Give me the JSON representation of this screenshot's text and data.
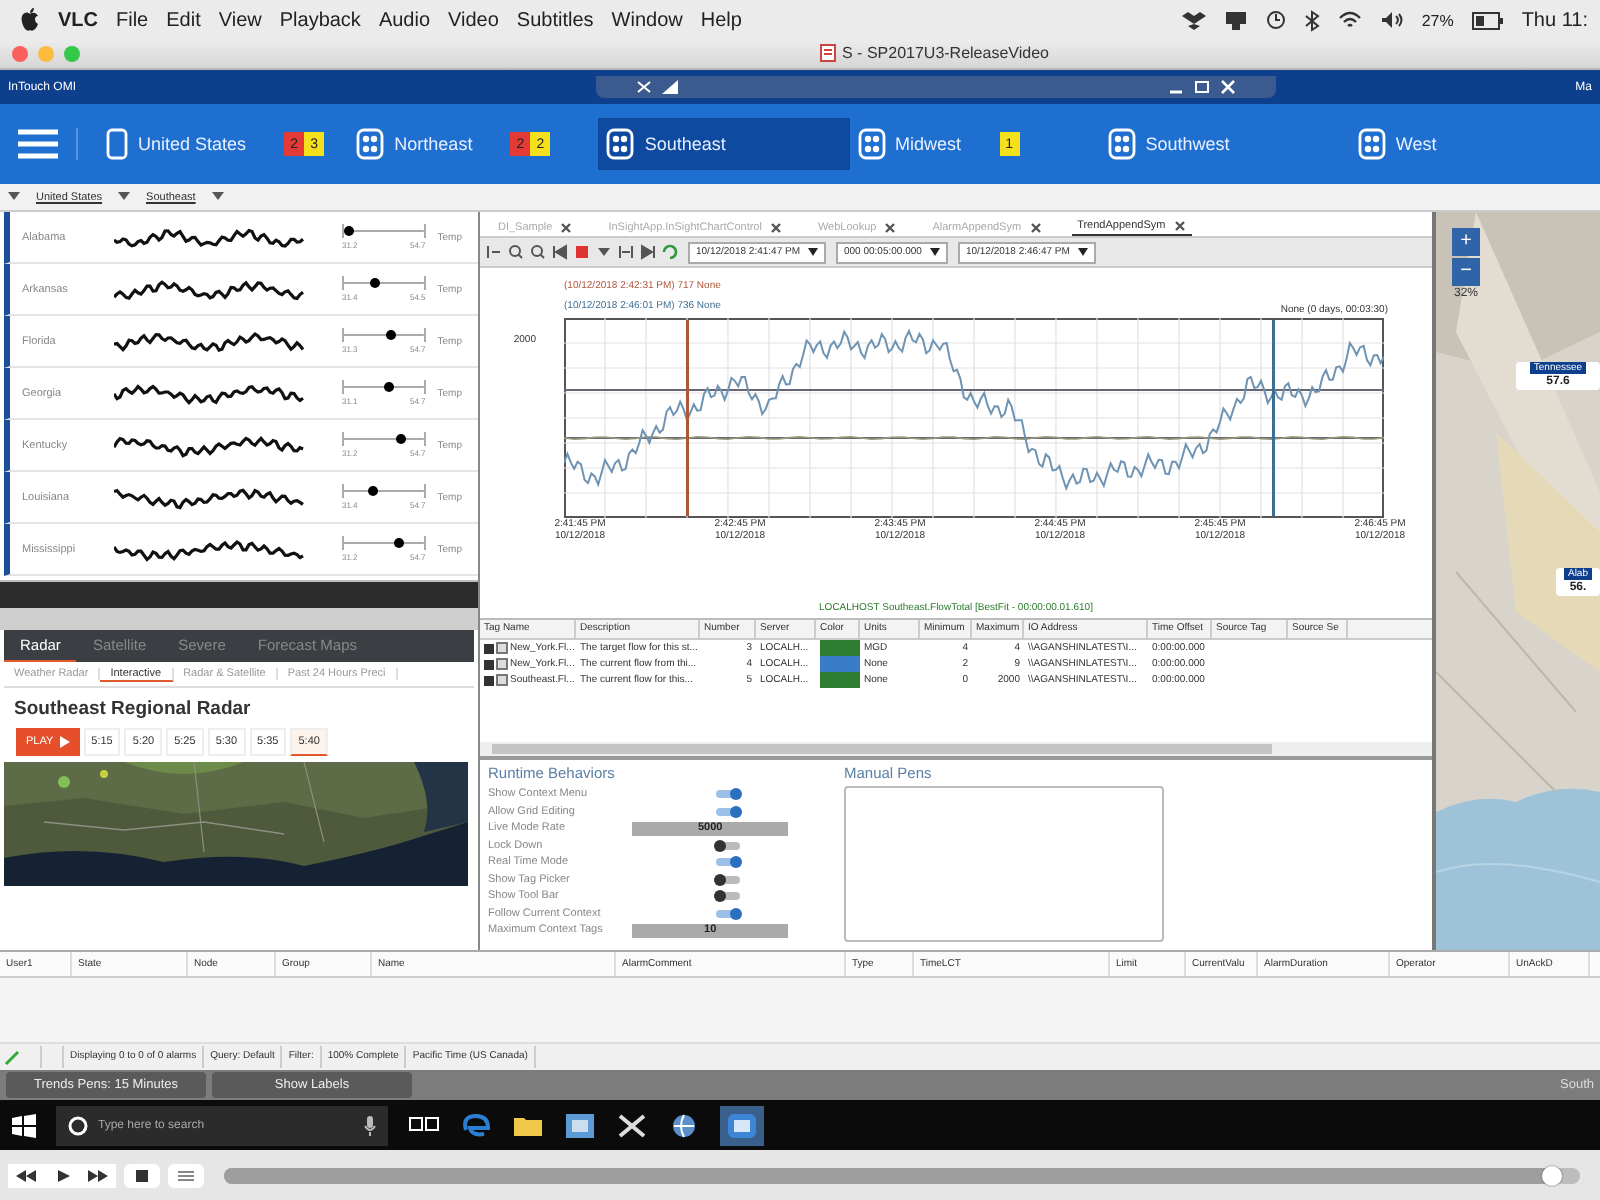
{
  "menubar": {
    "app": "VLC",
    "items": [
      "File",
      "Edit",
      "View",
      "Playback",
      "Audio",
      "Video",
      "Subtitles",
      "Window",
      "Help"
    ],
    "battery": "27%",
    "clock": "Thu 11:"
  },
  "window": {
    "title": "S - SP2017U3-ReleaseVideo"
  },
  "app_header": {
    "title": "InTouch OMI",
    "right": "Ma"
  },
  "nav": [
    {
      "label": "United States",
      "selected": false,
      "badges": [
        {
          "text": "2",
          "color": "#e53935"
        },
        {
          "text": "3",
          "color": "#f5e11b"
        }
      ]
    },
    {
      "label": "Northeast",
      "selected": false,
      "badges": [
        {
          "text": "2",
          "color": "#e53935"
        },
        {
          "text": "2",
          "color": "#f5e11b"
        }
      ]
    },
    {
      "label": "Southeast",
      "selected": true
    },
    {
      "label": "Midwest",
      "selected": false,
      "badges": [
        {
          "text": "1",
          "color": "#f5e11b"
        }
      ]
    },
    {
      "label": "Southwest",
      "selected": false
    },
    {
      "label": "West",
      "selected": false
    }
  ],
  "breadcrumb": [
    "United States",
    "Southeast"
  ],
  "states": [
    {
      "name": "Alabama",
      "level": 0.05,
      "min": "31.2",
      "max": "54.7",
      "unit": "Temp"
    },
    {
      "name": "Arkansas",
      "level": 0.38,
      "min": "31.4",
      "max": "54.5",
      "unit": "Temp"
    },
    {
      "name": "Florida",
      "level": 0.57,
      "min": "31.3",
      "max": "54.7",
      "unit": "Temp"
    },
    {
      "name": "Georgia",
      "level": 0.55,
      "min": "31.1",
      "max": "54.7",
      "unit": "Temp"
    },
    {
      "name": "Kentucky",
      "level": 0.7,
      "min": "31.2",
      "max": "54.7",
      "unit": "Temp"
    },
    {
      "name": "Louisiana",
      "level": 0.35,
      "min": "31.4",
      "max": "54.7",
      "unit": "Temp"
    },
    {
      "name": "Mississippi",
      "level": 0.68,
      "min": "31.2",
      "max": "54.7",
      "unit": "Temp"
    }
  ],
  "radar": {
    "tabs": [
      {
        "label": "Radar",
        "selected": true
      },
      {
        "label": "Satellite",
        "selected": false
      },
      {
        "label": "Severe",
        "selected": false
      },
      {
        "label": "Forecast Maps",
        "selected": false
      }
    ],
    "subtabs": [
      {
        "label": "Weather Radar",
        "selected": false
      },
      {
        "label": "Interactive",
        "selected": true
      },
      {
        "label": "Radar & Satellite",
        "selected": false
      },
      {
        "label": "Past 24 Hours Preci",
        "selected": false
      }
    ],
    "heading": "Southeast Regional Radar",
    "play": "PLAY",
    "times": [
      {
        "label": "5:15",
        "selected": false
      },
      {
        "label": "5:20",
        "selected": false
      },
      {
        "label": "5:25",
        "selected": false
      },
      {
        "label": "5:30",
        "selected": false
      },
      {
        "label": "5:35",
        "selected": false
      },
      {
        "label": "5:40",
        "selected": true
      }
    ]
  },
  "trend": {
    "tabs": [
      {
        "label": "DI_Sample",
        "selected": false
      },
      {
        "label": "InSightApp.InSightChartControl",
        "selected": false
      },
      {
        "label": "WebLookup",
        "selected": false
      },
      {
        "label": "AlarmAppendSym",
        "selected": false
      },
      {
        "label": "TrendAppendSym",
        "selected": true
      }
    ],
    "toolbar": {
      "start": "10/12/2018  2:41:47 PM",
      "duration": "000 00:05:00.000",
      "end": "10/12/2018  2:46:47 PM"
    },
    "legend": [
      {
        "text": "(10/12/2018 2:42:31 PM) 717 None",
        "color": "#b0553a"
      },
      {
        "text": "(10/12/2018 2:46:01 PM) 736 None",
        "color": "#3d6f94"
      }
    ],
    "cursor_info": "None (0 days, 00:03:30)",
    "y_label": "2000",
    "x_labels": [
      {
        "time": "2:41:45 PM",
        "date": "10/12/2018"
      },
      {
        "time": "2:42:45 PM",
        "date": "10/12/2018"
      },
      {
        "time": "2:43:45 PM",
        "date": "10/12/2018"
      },
      {
        "time": "2:44:45 PM",
        "date": "10/12/2018"
      },
      {
        "time": "2:45:45 PM",
        "date": "10/12/2018"
      },
      {
        "time": "2:46:45 PM",
        "date": "10/12/2018"
      }
    ],
    "caption": "LOCALHOST Southeast.FlowTotal [BestFit - 00:00:00.01.610]"
  },
  "tag_table": {
    "columns": [
      "Tag Name",
      "Description",
      "Number",
      "Server",
      "Color",
      "Units",
      "Minimum",
      "Maximum",
      "IO Address",
      "Time Offset",
      "Source Tag",
      "Source Se"
    ],
    "rows": [
      {
        "checked": true,
        "color": "#2e7d32",
        "cells": [
          "New_York.Fl...",
          "The target flow for this st...",
          "3",
          "LOCALH...",
          "",
          "MGD",
          "4",
          "4",
          "\\\\AGANSHINLATEST\\I...",
          "0:00:00.000"
        ]
      },
      {
        "checked": true,
        "color": "#3a7cc8",
        "cells": [
          "New_York.Fl...",
          "The current flow from thi...",
          "4",
          "LOCALH...",
          "",
          "None",
          "2",
          "9",
          "\\\\AGANSHINLATEST\\I...",
          "0:00:00.000"
        ]
      },
      {
        "checked": true,
        "color": "#2e7d32",
        "cells": [
          "Southeast.Fl...",
          "The current flow for this...",
          "5",
          "LOCALH...",
          "",
          "None",
          "0",
          "2000",
          "\\\\AGANSHINLATEST\\I...",
          "0:00:00.000"
        ]
      }
    ]
  },
  "runtime": {
    "title": "Runtime Behaviors",
    "items": [
      {
        "kind": "toggle",
        "label": "Show Context Menu",
        "on": true
      },
      {
        "kind": "toggle",
        "label": "Allow Grid Editing",
        "on": true
      },
      {
        "kind": "number",
        "label": "Live Mode Rate",
        "value": "5000"
      },
      {
        "kind": "toggle",
        "label": "Lock Down",
        "on": false
      },
      {
        "kind": "toggle",
        "label": "Real Time Mode",
        "on": true
      },
      {
        "kind": "toggle",
        "label": "Show Tag Picker",
        "on": false
      },
      {
        "kind": "toggle",
        "label": "Show Tool Bar",
        "on": false
      },
      {
        "kind": "toggle",
        "label": "Follow Current Context",
        "on": true
      },
      {
        "kind": "number",
        "label": "Maximum Context Tags",
        "value": "10"
      }
    ]
  },
  "manual_pens": {
    "title": "Manual Pens"
  },
  "map": {
    "zoom_in": "+",
    "zoom_out": "−",
    "zoom_level": "32%",
    "markers": [
      {
        "name": "Tennessee",
        "value": "57.6"
      },
      {
        "name": "Alab",
        "value": "56."
      }
    ]
  },
  "alarms": {
    "columns": [
      "User1",
      "State",
      "Node",
      "Group",
      "Name",
      "AlarmComment",
      "Type",
      "TimeLCT",
      "Limit",
      "CurrentValu",
      "AlarmDuration",
      "Operator",
      "UnAckD"
    ],
    "status": [
      "Displaying 0 to 0 of 0 alarms",
      "Query: Default",
      "Filter:",
      "100% Complete",
      "Pacific Time (US  Canada)"
    ]
  },
  "footer": {
    "buttons": [
      "Trends Pens: 15 Minutes",
      "Show Labels"
    ],
    "right": "South"
  },
  "taskbar": {
    "search_placeholder": "Type here to search"
  },
  "player": {
    "level": 0.98
  }
}
